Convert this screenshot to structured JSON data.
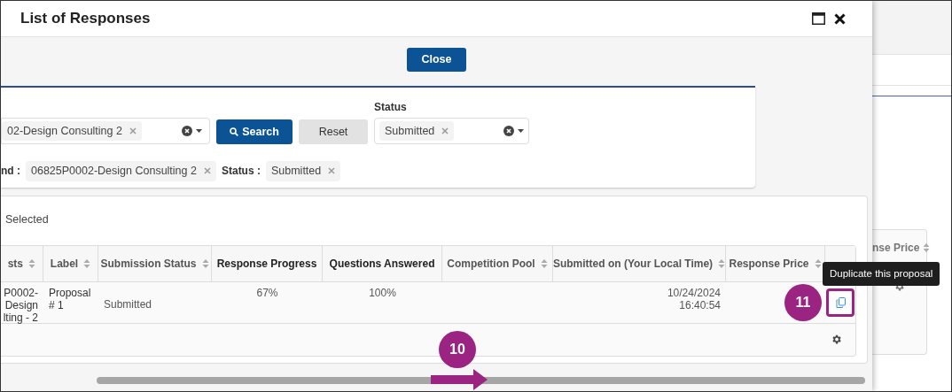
{
  "dialog": {
    "title": "List of Responses",
    "close_button": "Close"
  },
  "filters": {
    "field_value": "02-Design Consulting 2",
    "search_button": "Search",
    "reset_button": "Reset",
    "status_label": "Status",
    "status_value": "Submitted",
    "applied": [
      {
        "label": "nd :",
        "value": "06825P0002-Design Consulting 2"
      },
      {
        "label": "Status :",
        "value": "Submitted"
      }
    ]
  },
  "table": {
    "selected_text": "Selected",
    "columns": [
      {
        "label": "sts",
        "sortable": true
      },
      {
        "label": "Label",
        "sortable": true
      },
      {
        "label": "Submission Status",
        "sortable": true
      },
      {
        "label": "Response Progress",
        "sortable": false
      },
      {
        "label": "Questions Answered",
        "sortable": false
      },
      {
        "label": "Competition Pool",
        "sortable": true
      },
      {
        "label": "Submitted on (Your Local Time)",
        "sortable": true
      },
      {
        "label": "Response Price",
        "sortable": true
      }
    ],
    "rows": [
      {
        "cells": [
          "P0002-\nDesign\nlting - 2",
          "Proposal\n# 1",
          "Submitted",
          "67%",
          "100%",
          null,
          "10/24/2024\n16:40:54",
          null
        ]
      }
    ]
  },
  "tooltip": "Duplicate this proposal",
  "callouts": [
    {
      "number": "10"
    },
    {
      "number": "11"
    }
  ],
  "background": {
    "column_label": "nse Price"
  }
}
